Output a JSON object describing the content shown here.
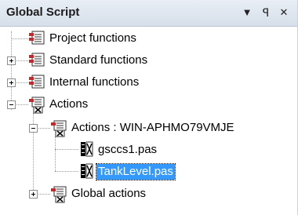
{
  "panel": {
    "title": "Global Script",
    "dropdown_icon": "chevron-down-icon",
    "pin_icon": "pin-icon",
    "close_icon": "close-icon"
  },
  "tree": {
    "items": [
      {
        "label": "Project functions",
        "icon": "functions-icon",
        "expander": "none"
      },
      {
        "label": "Standard functions",
        "icon": "functions-icon",
        "expander": "collapsed"
      },
      {
        "label": "Internal functions",
        "icon": "functions-icon",
        "expander": "collapsed"
      },
      {
        "label": "Actions",
        "icon": "actions-icon",
        "expander": "expanded"
      },
      {
        "label": "Actions : WIN-APHMO79VMJE",
        "icon": "actions-icon",
        "expander": "expanded"
      },
      {
        "label": "gsccs1.pas",
        "icon": "script-file-icon",
        "expander": "none"
      },
      {
        "label": "TankLevel.pas",
        "icon": "script-file-icon",
        "expander": "none",
        "selected": true
      },
      {
        "label": "Global actions",
        "icon": "actions-icon",
        "expander": "collapsed"
      }
    ]
  },
  "colors": {
    "selection": "#3399ff",
    "titlebar": "#dfe6ef",
    "icon_red": "#c8262a"
  }
}
